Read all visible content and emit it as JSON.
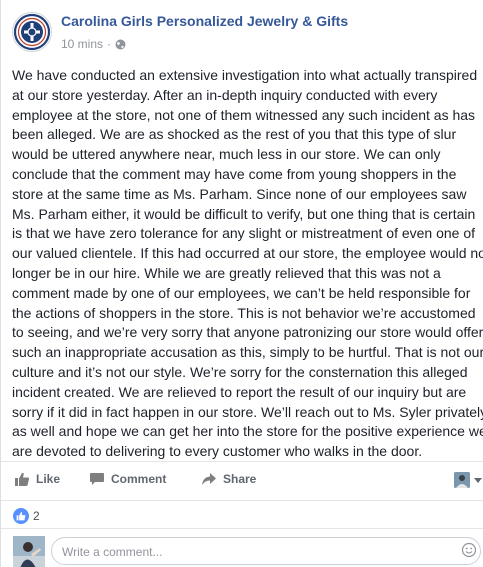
{
  "post": {
    "page_name": "Carolina Girls Personalized Jewelry & Gifts",
    "timestamp": "10 mins",
    "separator": "·",
    "privacy_icon": "globe-icon",
    "lines": [
      "We have conducted an extensive investigation into what actually transpired",
      "at our store yesterday. After an in-depth inquiry conducted with every",
      "employee at the store, not one of them witnessed any such incident as has",
      "been alleged. We are as shocked as the rest of you that this type of slur",
      "would be uttered anywhere near, much less in our store. We can only",
      "conclude that the comment may have come from young shoppers in the",
      "store at the same time as Ms. Parham. Since none of our employees saw",
      "Ms. Parham either, it would be difficult to verify, but one thing that is certain",
      "is that we have zero tolerance for any slight or mistreatment of even one of",
      "our valued clientele. If this had occurred at our store, the employee would no",
      "longer be in our hire. While we are greatly relieved that this was not a",
      "comment made by one of our employees, we can’t be held responsible for",
      "the actions of shoppers in the store. This is not behavior we’re accustomed",
      "to seeing, and we’re very sorry that anyone patronizing our store would offer",
      "such an inappropriate accusation as this, simply to be hurtful. That is not our",
      "culture and it’s not our style. We’re sorry for the consternation this alleged",
      "incident created. We are relieved to report the result of our inquiry but are",
      "sorry if it did in fact happen in our store. We’ll reach out to Ms. Syler privately",
      "as well and hope we can get her into the store for the positive experience we",
      "are devoted to delivering to every customer who walks in the door."
    ]
  },
  "actions": {
    "like": "Like",
    "comment": "Comment",
    "share": "Share"
  },
  "reactions": {
    "count": "2"
  },
  "composer": {
    "placeholder": "Write a comment..."
  },
  "colors": {
    "link": "#365899",
    "like_badge": "#5890ff",
    "action_text": "#616770"
  }
}
